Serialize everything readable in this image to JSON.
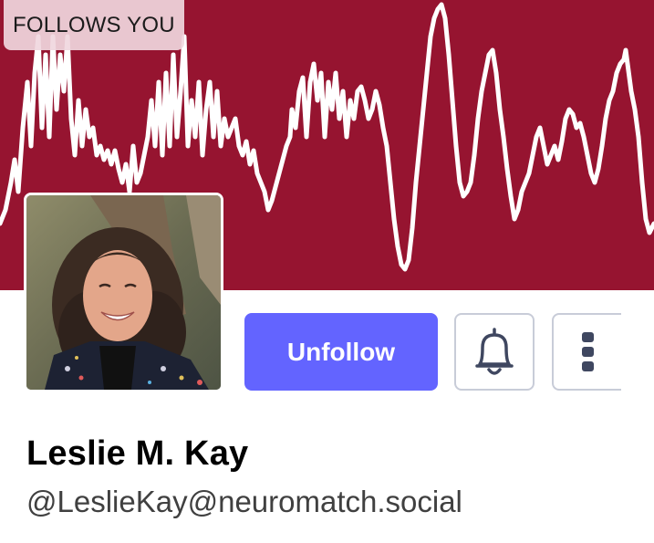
{
  "header": {
    "badge_text": "FOLLOWS YOU",
    "banner_color": "#961430",
    "waveform_color": "#ffffff"
  },
  "profile": {
    "display_name": "Leslie M. Kay",
    "handle": "@LeslieKay@neuromatch.social",
    "avatar_alt": "Leslie M. Kay"
  },
  "actions": {
    "unfollow_label": "Unfollow",
    "unfollow_color": "#6364ff",
    "notify_icon": "bell-icon",
    "more_icon": "vertical-ellipsis-icon"
  }
}
